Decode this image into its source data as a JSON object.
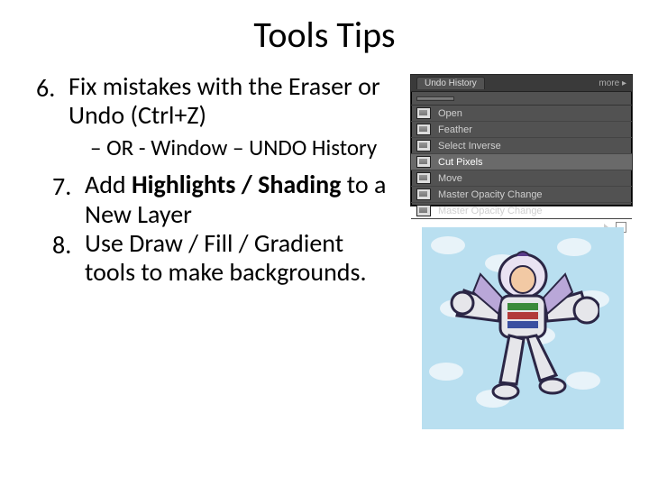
{
  "title": "Tools Tips",
  "items": {
    "six": {
      "num": "6.",
      "text": "Fix mistakes with the Eraser or Undo (Ctrl+Z)"
    },
    "six_sub": "– OR - Window – UNDO History",
    "seven": {
      "num": "7.",
      "pre": "Add ",
      "bold": "Highlights / Shading",
      "post": " to a New Layer"
    },
    "eight": {
      "num": "8.",
      "text": "Use Draw / Fill / Gradient tools to make backgrounds."
    }
  },
  "panel": {
    "tab": "Undo History",
    "more": "more ▸",
    "rows": [
      "Open",
      "Feather",
      "Select Inverse",
      "Cut Pixels",
      "Move",
      "Master Opacity Change",
      "Master Opacity Change"
    ],
    "active_index": 3
  }
}
